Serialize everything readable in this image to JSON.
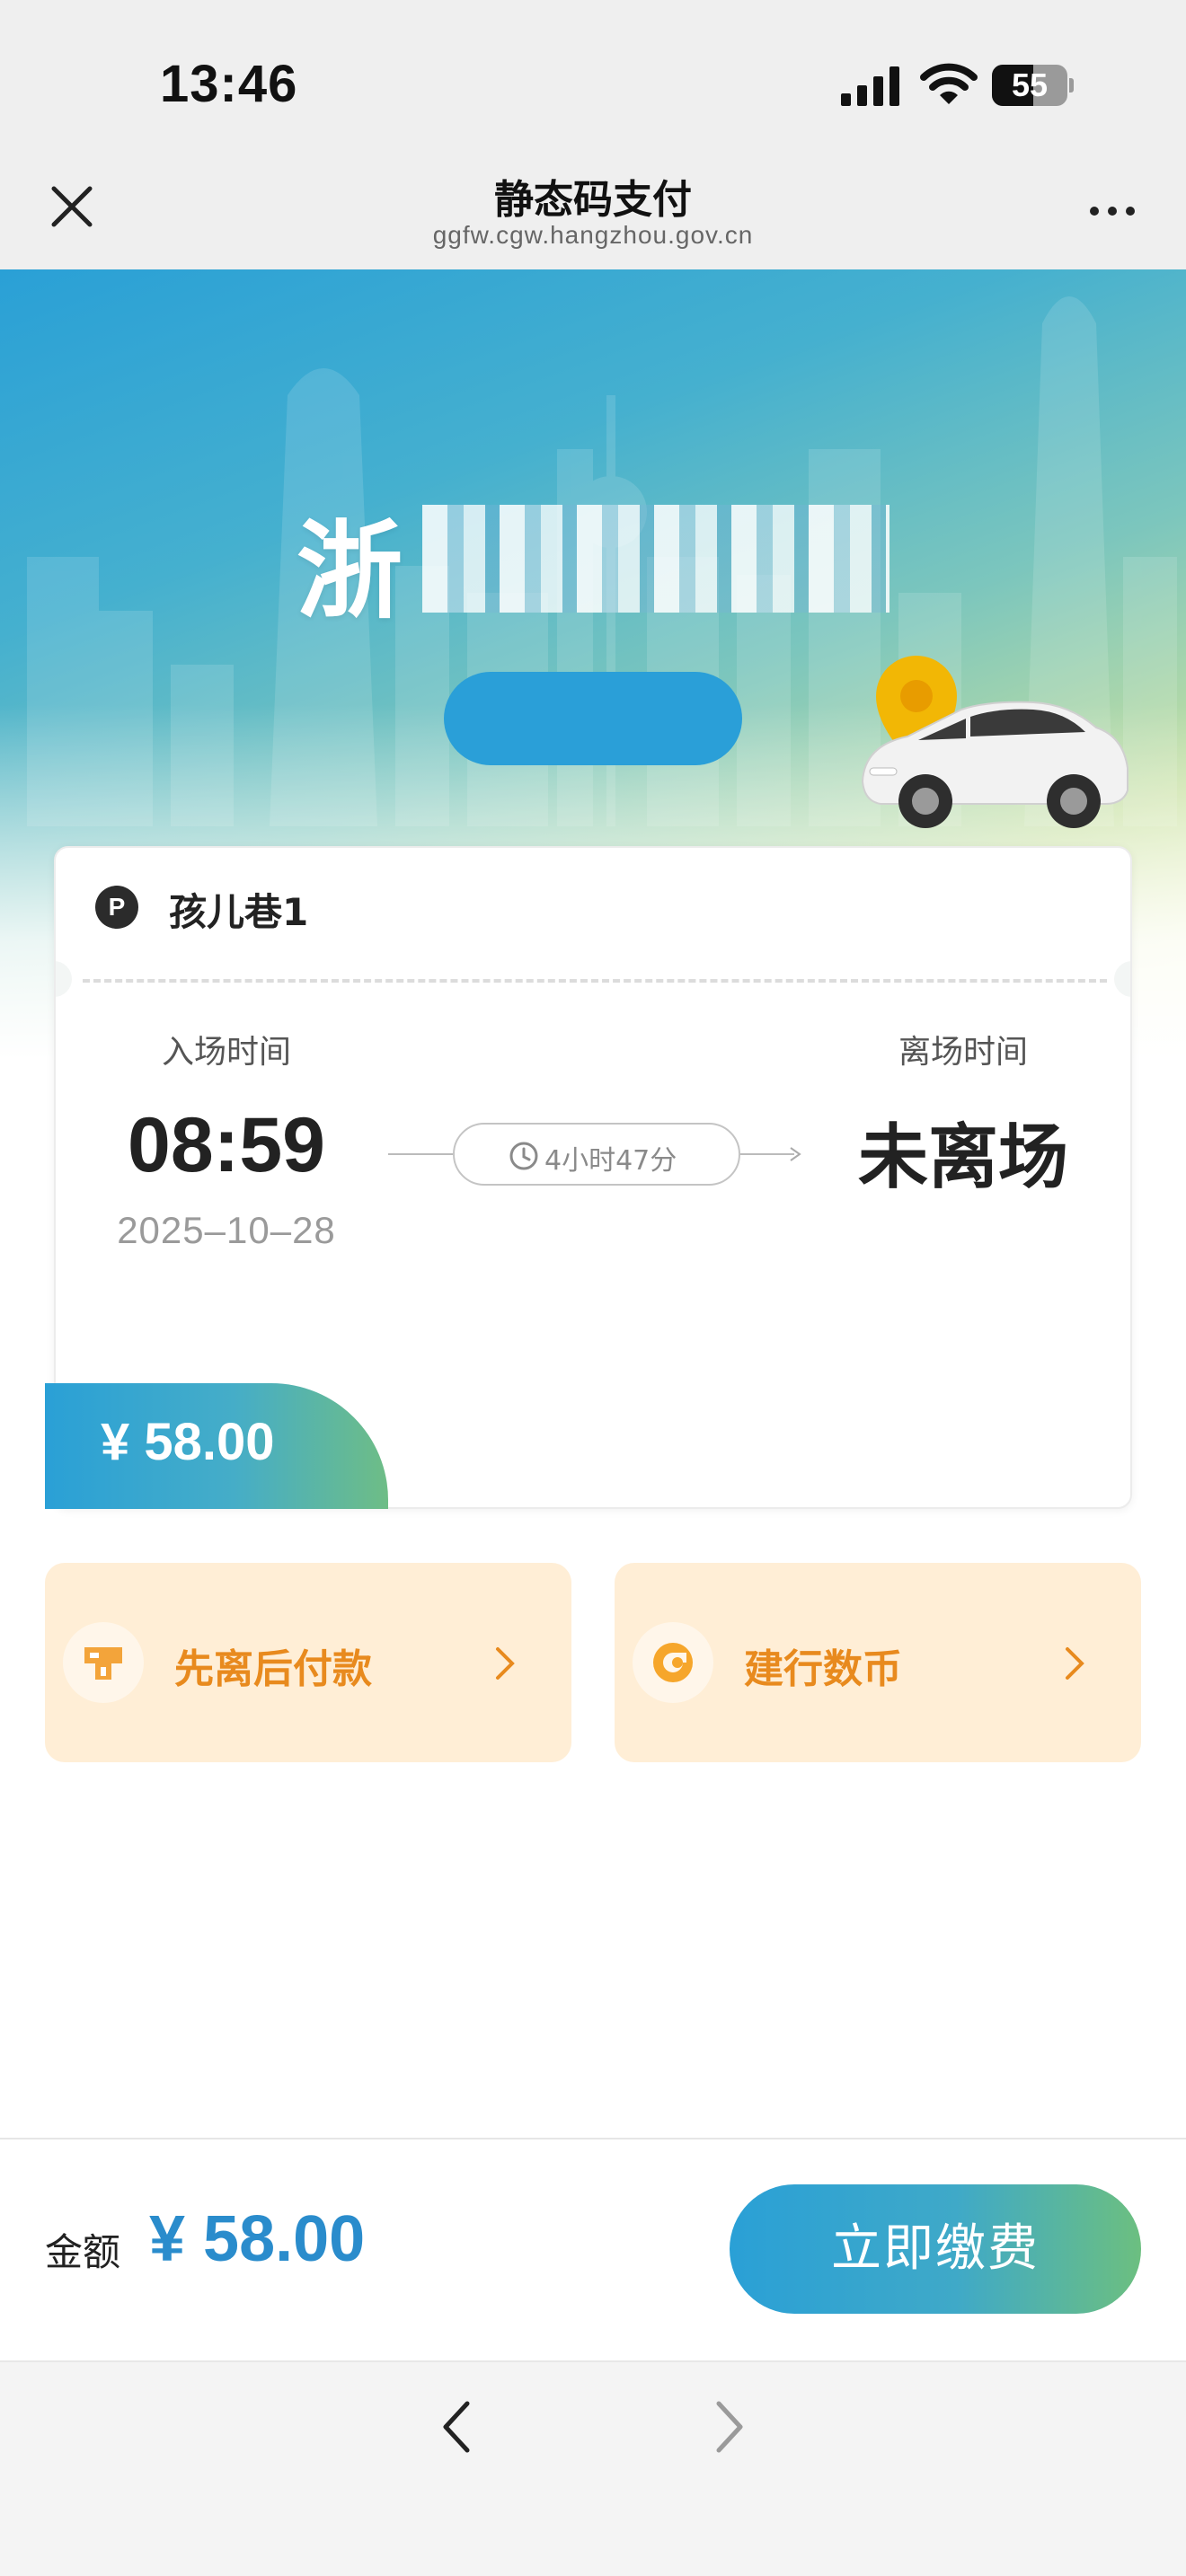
{
  "status_bar": {
    "time": "13:46",
    "battery_level": "55",
    "icons": [
      "signal-icon",
      "wifi-icon",
      "battery-icon"
    ]
  },
  "nav": {
    "title": "静态码支付",
    "url": "ggfw.cgw.hangzhou.gov.cn",
    "icons": [
      "close-icon",
      "more-icon"
    ]
  },
  "hero": {
    "plate_prefix": "浙"
  },
  "parking": {
    "lot_icon": "P",
    "lot_name": "孩儿巷1",
    "entry_label": "入场时间",
    "entry_time": "08:59",
    "entry_date": "2025–10–28",
    "exit_label": "离场时间",
    "exit_value": "未离场",
    "duration": "4小时47分",
    "fee": "¥ 58.00"
  },
  "options": [
    {
      "label": "先离后付款",
      "icon": "pay-later-icon"
    },
    {
      "label": "建行数币",
      "icon": "ccb-digital-currency-icon"
    }
  ],
  "payment": {
    "amount_label": "金额",
    "amount_value": "¥ 58.00",
    "pay_button": "立即缴费"
  },
  "toolbar": {
    "icons": [
      "back-icon",
      "forward-icon"
    ]
  },
  "colors": {
    "accent_blue": "#2a9fd8",
    "accent_green": "#6cbf80",
    "amount_blue": "#2a8ccc",
    "tile_bg": "#ffeed6",
    "tile_text": "#e88a1e"
  }
}
